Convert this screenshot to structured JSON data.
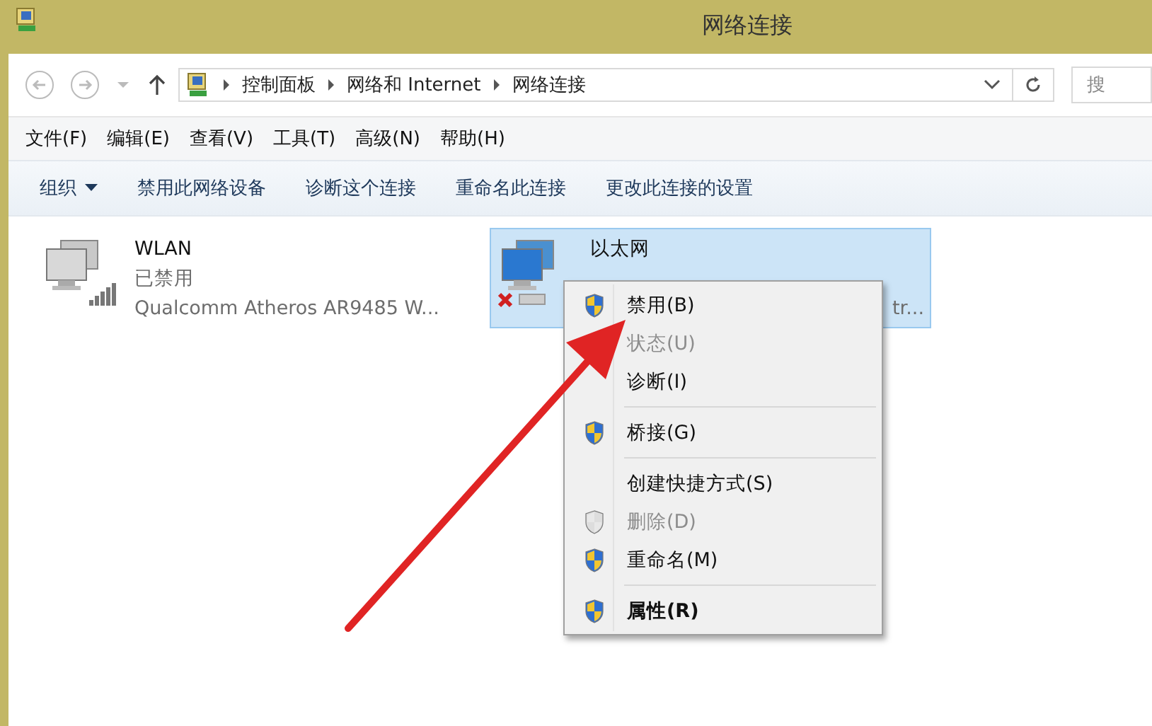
{
  "window": {
    "title": "网络连接"
  },
  "address_bar": {
    "path": [
      "控制面板",
      "网络和 Internet",
      "网络连接"
    ],
    "search_placeholder": "搜"
  },
  "menu_bar": [
    "文件(F)",
    "编辑(E)",
    "查看(V)",
    "工具(T)",
    "高级(N)",
    "帮助(H)"
  ],
  "command_bar": [
    {
      "label": "组织",
      "dropdown": true
    },
    {
      "label": "禁用此网络设备",
      "dropdown": false
    },
    {
      "label": "诊断这个连接",
      "dropdown": false
    },
    {
      "label": "重命名此连接",
      "dropdown": false
    },
    {
      "label": "更改此连接的设置",
      "dropdown": false
    }
  ],
  "connections": [
    {
      "kind": "wifi",
      "name": "WLAN",
      "status": "已禁用",
      "device": "Qualcomm Atheros AR9485 W...",
      "selected": false
    },
    {
      "kind": "ethernet",
      "name": "以太网",
      "device": "tr...",
      "selected": true
    }
  ],
  "context_menu": {
    "groups": [
      [
        {
          "label": "禁用(B)",
          "shield": true,
          "disabled": false,
          "default": false
        },
        {
          "label": "状态(U)",
          "shield": false,
          "disabled": true,
          "default": false
        },
        {
          "label": "诊断(I)",
          "shield": false,
          "disabled": false,
          "default": false
        }
      ],
      [
        {
          "label": "桥接(G)",
          "shield": true,
          "disabled": false,
          "default": false
        }
      ],
      [
        {
          "label": "创建快捷方式(S)",
          "shield": false,
          "disabled": false,
          "default": false
        },
        {
          "label": "删除(D)",
          "shield": true,
          "disabled": true,
          "default": false
        },
        {
          "label": "重命名(M)",
          "shield": true,
          "disabled": false,
          "default": false
        }
      ],
      [
        {
          "label": "属性(R)",
          "shield": true,
          "disabled": false,
          "default": true
        }
      ]
    ]
  }
}
